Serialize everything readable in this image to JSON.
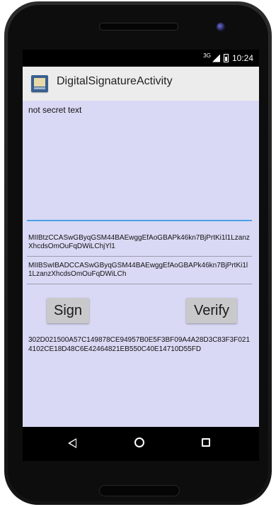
{
  "status_bar": {
    "network": "3G",
    "time": "10:24"
  },
  "app": {
    "title": "DigitalSignatureActivity",
    "icon": "app-icon"
  },
  "input": {
    "text": "not secret text"
  },
  "keys": {
    "public_key": "MIIBtzCCASwGByqGSM44BAEwggEfAoGBAPk46kn7BjPrtKi1l1LzanzXhcdsOmOuFqDWiLChjYl1",
    "private_key": "MIIBSwIBADCCASwGByqGSM44BAEwggEfAoGBAPk46kn7BjPrtKi1l1LzanzXhcdsOmOuFqDWiLCh"
  },
  "buttons": {
    "sign": "Sign",
    "verify": "Verify"
  },
  "signature": {
    "hex": "302D021500A57C149878CE94957B0E5F3BF09A4A28D3C83F3F0214102CE18D48C6E42464821EB550C40E14710D55FD"
  },
  "nav": {
    "back_icon": "back-icon",
    "home_icon": "home-icon",
    "recents_icon": "recents-icon"
  },
  "colors": {
    "content_bg": "#d9d9f5",
    "accent_underline": "#4aa0e6",
    "action_bar_bg": "#ececec",
    "button_bg": "#c9c9cc"
  }
}
